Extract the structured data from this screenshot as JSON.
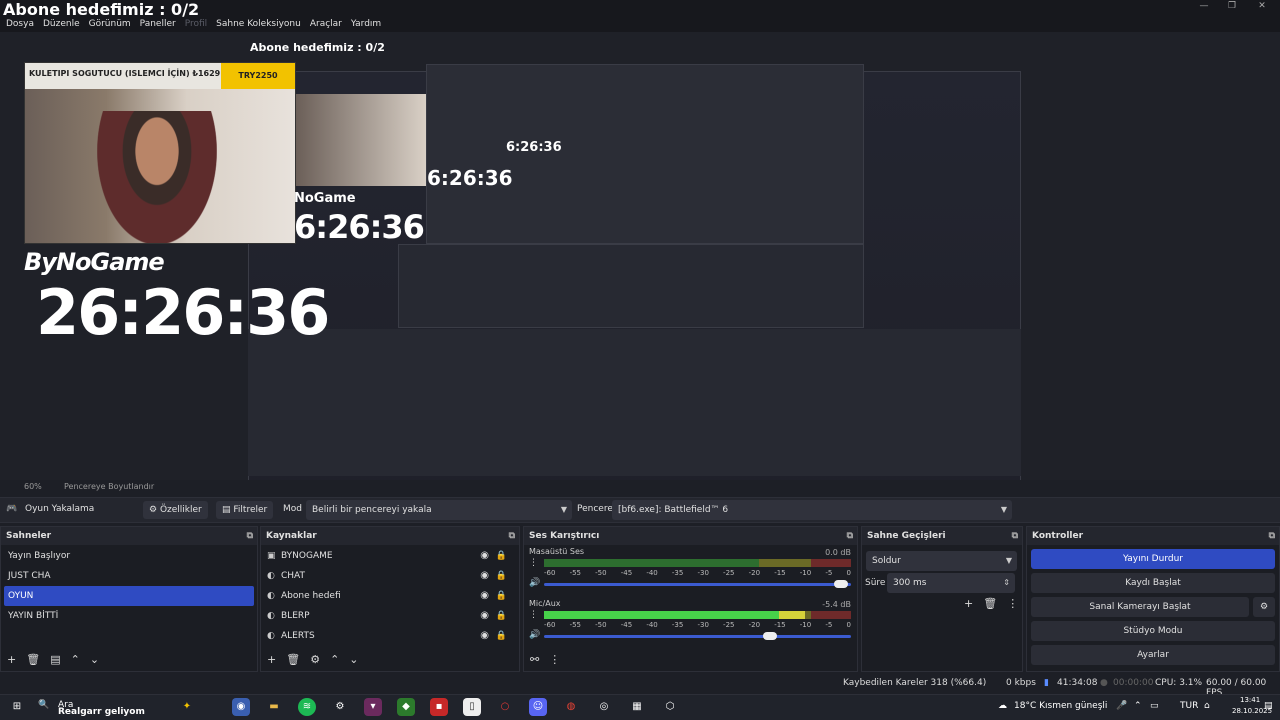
{
  "window": {
    "title": "Abone hedefimiz : 0/2",
    "controls": [
      "—",
      "❐",
      "✕"
    ]
  },
  "menu": [
    {
      "label": "Dosya",
      "dim": false
    },
    {
      "label": "Düzenle",
      "dim": false
    },
    {
      "label": "Görünüm",
      "dim": false
    },
    {
      "label": "Paneller",
      "dim": false
    },
    {
      "label": "Profil",
      "dim": true
    },
    {
      "label": "Sahne Koleksiyonu",
      "dim": false
    },
    {
      "label": "Araçlar",
      "dim": false
    },
    {
      "label": "Yardım",
      "dim": false
    }
  ],
  "preview": {
    "banner_text": "KULETIPI SOGUTUCU (ISLEMCI İÇİN) ₺1629.00",
    "banner_tag": "TRY2250",
    "brand": "ByNoGame",
    "timer": "26:26:36",
    "echo_brand": "NoGame",
    "echo_timer": "6:26:36",
    "echo_timer_small": "6:26:36",
    "echo_timer_tiny": "6:26:36"
  },
  "zoom": {
    "level": "60%",
    "fit_label": "Pencereye Boyutlandır"
  },
  "source_toolbar": {
    "source_name": "Oyun Yakalama",
    "properties_label": "Özellikler",
    "filters_label": "Filtreler",
    "mode_label": "Mod",
    "mode_value": "Belirli bir pencereyi yakala",
    "window_label": "Pencere",
    "window_value": "[bf6.exe]: Battlefield™ 6"
  },
  "scenes": {
    "title": "Sahneler",
    "items": [
      "Yayın Başlıyor",
      "JUST CHA",
      "OYUN",
      "YAYIN BİTTİ"
    ],
    "selected_index": 2
  },
  "sources": {
    "title": "Kaynaklar",
    "items": [
      {
        "name": "BYNOGAME",
        "icon": "image-icon"
      },
      {
        "name": "CHAT",
        "icon": "globe-icon"
      },
      {
        "name": "Abone hedefi",
        "icon": "globe-icon"
      },
      {
        "name": "BLERP",
        "icon": "globe-icon"
      },
      {
        "name": "ALERTS",
        "icon": "globe-icon"
      }
    ]
  },
  "mixer": {
    "title": "Ses Karıştırıcı",
    "ticks": [
      "-60",
      "-55",
      "-50",
      "-45",
      "-40",
      "-35",
      "-30",
      "-25",
      "-20",
      "-15",
      "-10",
      "-5",
      "0"
    ],
    "channels": [
      {
        "name": "Masaüstü Ses",
        "db": "0.0 dB",
        "level": 0,
        "volume": 0.99
      },
      {
        "name": "Mic/Aux",
        "db": "-5.4 dB",
        "level": 0.85,
        "volume": 0.76
      }
    ]
  },
  "transitions": {
    "title": "Sahne Geçişleri",
    "type": "Soldur",
    "duration_label": "Süre",
    "duration_value": "300 ms"
  },
  "controls": {
    "title": "Kontroller",
    "stop_stream": "Yayını Durdur",
    "start_recording": "Kaydı Başlat",
    "start_virtual_cam": "Sanal Kamerayı Başlat",
    "studio_mode": "Stüdyo Modu",
    "settings": "Ayarlar"
  },
  "status": {
    "dropped_frames": "Kaybedilen Kareler 318 (%66.4)",
    "kbps": "0 kbps",
    "stream_time": "41:34:08",
    "record_time": "00:00:00",
    "cpu": "CPU: 3.1%",
    "fps": "60.00 / 60.00 FPS"
  },
  "taskbar": {
    "search": "Ara",
    "profile_text": "Realgarr geliyom",
    "weather": "18°C  Kısmen güneşli",
    "lang": "TUR",
    "time": "13:41",
    "date": "28.10.2025"
  }
}
